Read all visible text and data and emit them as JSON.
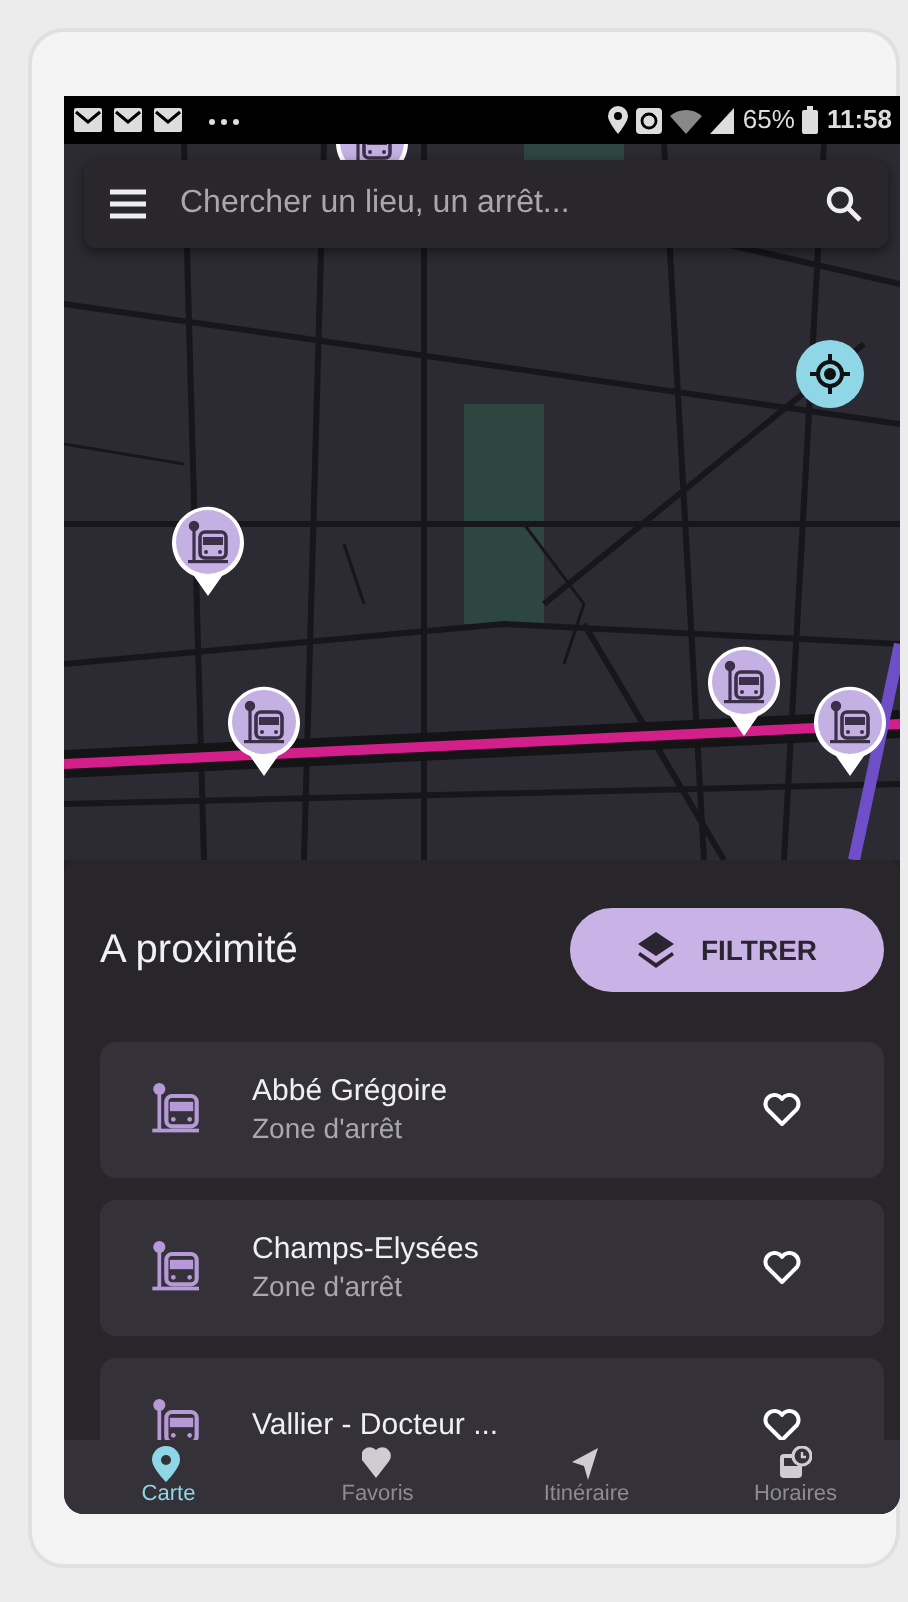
{
  "status_bar": {
    "battery": "65%",
    "time": "11:58"
  },
  "search": {
    "placeholder": "Chercher un lieu, un arrêt..."
  },
  "nearby": {
    "title": "A proximité",
    "filter_button": "FILTRER",
    "stops": [
      {
        "name": "Abbé Grégoire",
        "subtitle": "Zone d'arrêt",
        "favorite": false
      },
      {
        "name": "Champs-Elysées",
        "subtitle": "Zone d'arrêt",
        "favorite": false
      },
      {
        "name": "Vallier - Docteur ...",
        "favorite": false
      }
    ]
  },
  "bottom_nav": [
    {
      "label": "Carte",
      "kind": "map",
      "selected": true
    },
    {
      "label": "Favoris",
      "kind": "favorites",
      "selected": false
    },
    {
      "label": "Itinéraire",
      "kind": "route",
      "selected": false
    },
    {
      "label": "Horaires",
      "kind": "schedule",
      "selected": false
    }
  ]
}
